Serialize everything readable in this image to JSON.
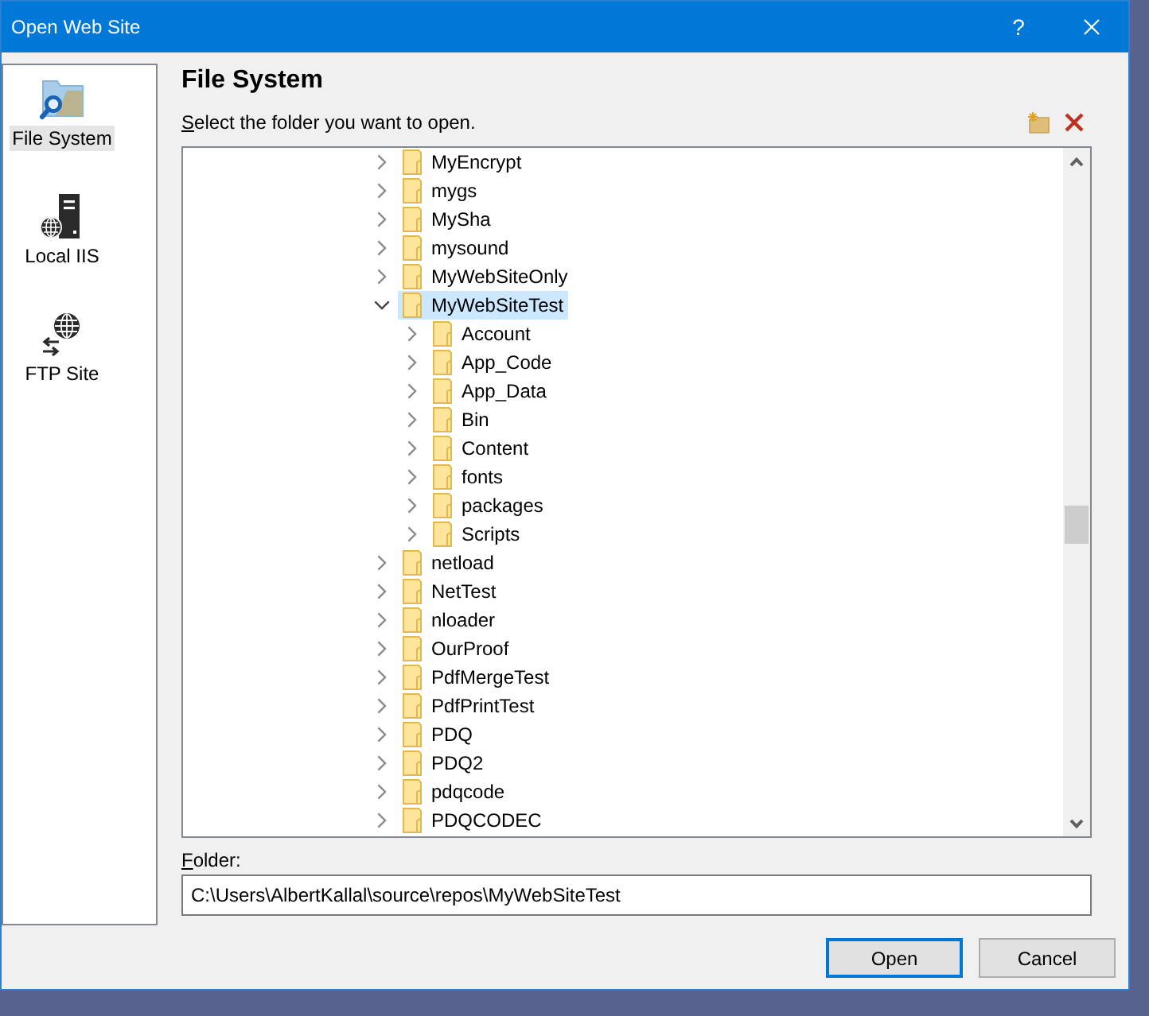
{
  "window": {
    "title": "Open Web Site",
    "help": "?"
  },
  "sidebar": {
    "items": [
      {
        "kind": "filesystem",
        "label": "File System",
        "selected": true
      },
      {
        "kind": "localiis",
        "label": "Local IIS",
        "selected": false
      },
      {
        "kind": "ftp",
        "label": "FTP Site",
        "selected": false
      }
    ]
  },
  "panel": {
    "heading": "File System",
    "instruction": "Select the folder you want to open."
  },
  "tree": {
    "items": [
      {
        "label": "MyEncrypt",
        "expanded": false,
        "selected": false
      },
      {
        "label": "mygs",
        "expanded": false,
        "selected": false
      },
      {
        "label": "MySha",
        "expanded": false,
        "selected": false
      },
      {
        "label": "mysound",
        "expanded": false,
        "selected": false
      },
      {
        "label": "MyWebSiteOnly",
        "expanded": false,
        "selected": false
      },
      {
        "label": "MyWebSiteTest",
        "expanded": true,
        "selected": true,
        "children": [
          {
            "label": "Account",
            "expanded": false,
            "selected": false
          },
          {
            "label": "App_Code",
            "expanded": false,
            "selected": false
          },
          {
            "label": "App_Data",
            "expanded": false,
            "selected": false
          },
          {
            "label": "Bin",
            "expanded": false,
            "selected": false
          },
          {
            "label": "Content",
            "expanded": false,
            "selected": false
          },
          {
            "label": "fonts",
            "expanded": false,
            "selected": false
          },
          {
            "label": "packages",
            "expanded": false,
            "selected": false
          },
          {
            "label": "Scripts",
            "expanded": false,
            "selected": false
          }
        ]
      },
      {
        "label": "netload",
        "expanded": false,
        "selected": false
      },
      {
        "label": "NetTest",
        "expanded": false,
        "selected": false
      },
      {
        "label": "nloader",
        "expanded": false,
        "selected": false
      },
      {
        "label": "OurProof",
        "expanded": false,
        "selected": false
      },
      {
        "label": "PdfMergeTest",
        "expanded": false,
        "selected": false
      },
      {
        "label": "PdfPrintTest",
        "expanded": false,
        "selected": false
      },
      {
        "label": "PDQ",
        "expanded": false,
        "selected": false
      },
      {
        "label": "PDQ2",
        "expanded": false,
        "selected": false
      },
      {
        "label": "pdqcode",
        "expanded": false,
        "selected": false
      },
      {
        "label": "PDQCODEC",
        "expanded": false,
        "selected": false
      }
    ]
  },
  "folder": {
    "label": "Folder:",
    "value": "C:\\Users\\AlbertKallal\\source\\repos\\MyWebSiteTest"
  },
  "buttons": [
    {
      "label": "Open",
      "default": true
    },
    {
      "label": "Cancel",
      "default": false
    }
  ]
}
